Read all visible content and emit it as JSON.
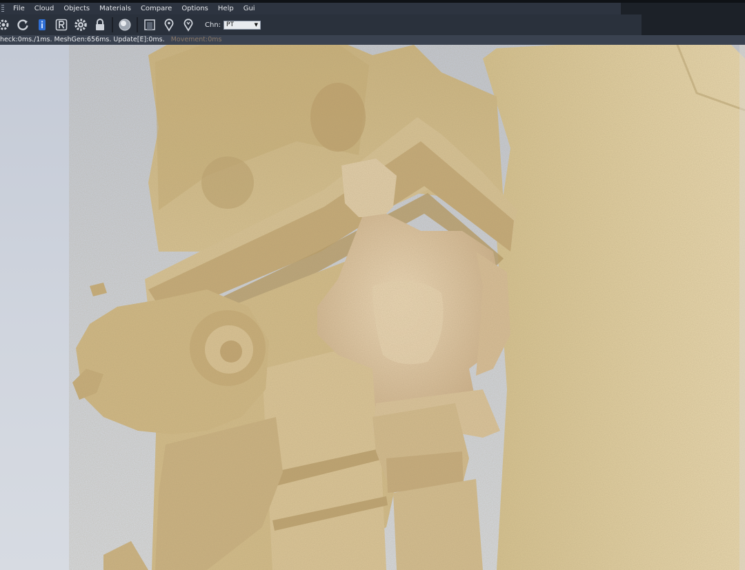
{
  "menu": [
    "File",
    "Cloud",
    "Objects",
    "Materials",
    "Compare",
    "Options",
    "Help",
    "Gui"
  ],
  "toolbar": {
    "icons": [
      "gear-icon",
      "refresh-icon",
      "info-icon",
      "r-icon",
      "settings-icon",
      "lock-icon",
      "sphere-icon",
      "frame-icon",
      "pin-icon",
      "marker-icon"
    ],
    "channel_label": "Chn:",
    "channel_value": "PT"
  },
  "status": {
    "text": "heck:0ms./1ms. MeshGen:656ms. Update[E]:0ms.",
    "faint_text": "Movement:0ms"
  },
  "colors": {
    "menu_bg": "#2d3440",
    "toolbar_bg": "#2a313c",
    "status_bg": "#3a4250",
    "viewport_bg": "#c9ced8",
    "model_base": "#d8c49a"
  }
}
